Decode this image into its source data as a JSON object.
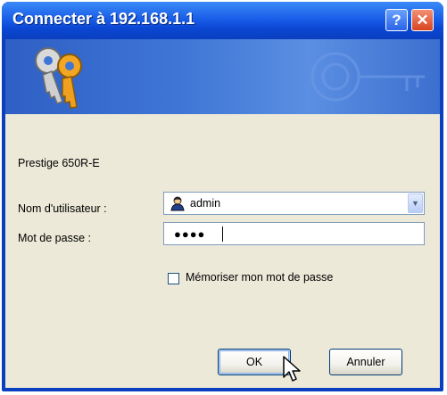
{
  "window": {
    "title": "Connecter à 192.168.1.1",
    "help_label": "?",
    "close_label": "✕"
  },
  "dialog": {
    "device_name": "Prestige 650R-E",
    "username_label": "Nom d'utilisateur :",
    "username_value": "admin",
    "password_label": "Mot de passe :",
    "password_masked": "●●●●",
    "remember_label": "Mémoriser mon mot de passe",
    "remember_checked": false
  },
  "buttons": {
    "ok_label": "OK",
    "cancel_label": "Annuler"
  },
  "colors": {
    "titlebar": "#0a3fbf",
    "client_bg": "#ece9d8",
    "close_button": "#d9431f"
  }
}
